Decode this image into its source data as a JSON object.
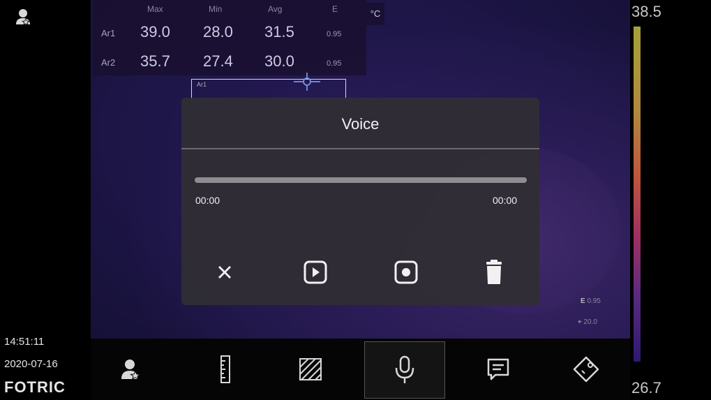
{
  "temperature_table": {
    "headers": [
      "Max",
      "Min",
      "Avg",
      "E"
    ],
    "rows": [
      {
        "label": "Ar1",
        "max": "39.0",
        "min": "28.0",
        "avg": "31.5",
        "emissivity": "0.95"
      },
      {
        "label": "Ar2",
        "max": "35.7",
        "min": "27.4",
        "avg": "30.0",
        "emissivity": "0.95"
      }
    ],
    "unit": "°C"
  },
  "roi_label": "Ar1",
  "scale": {
    "max": "38.5",
    "min": "26.7"
  },
  "params": {
    "emissivity_label": "E",
    "emissivity": "0.95",
    "distance": "20.0"
  },
  "status": {
    "time": "14:51:11",
    "date": "2020-07-16",
    "brand": "FOTRIC"
  },
  "dialog": {
    "title": "Voice",
    "progress": 0,
    "time_start": "00:00",
    "time_end": "00:00",
    "buttons": [
      {
        "name": "close",
        "icon": "close-icon"
      },
      {
        "name": "play",
        "icon": "play-icon"
      },
      {
        "name": "record",
        "icon": "record-icon"
      },
      {
        "name": "delete",
        "icon": "trash-icon"
      }
    ]
  },
  "toolbar": {
    "items": [
      {
        "name": "user",
        "icon": "user-star-icon",
        "active": false
      },
      {
        "name": "ruler",
        "icon": "ruler-icon",
        "active": false
      },
      {
        "name": "area",
        "icon": "hatched-area-icon",
        "active": false
      },
      {
        "name": "voice",
        "icon": "microphone-icon",
        "active": true
      },
      {
        "name": "text",
        "icon": "message-icon",
        "active": false
      },
      {
        "name": "tag",
        "icon": "tag-icon",
        "active": false
      }
    ]
  },
  "colors": {
    "accent": "#ffffff",
    "dialog_bg": "#302e34",
    "progress_track": "#8e8e92"
  }
}
